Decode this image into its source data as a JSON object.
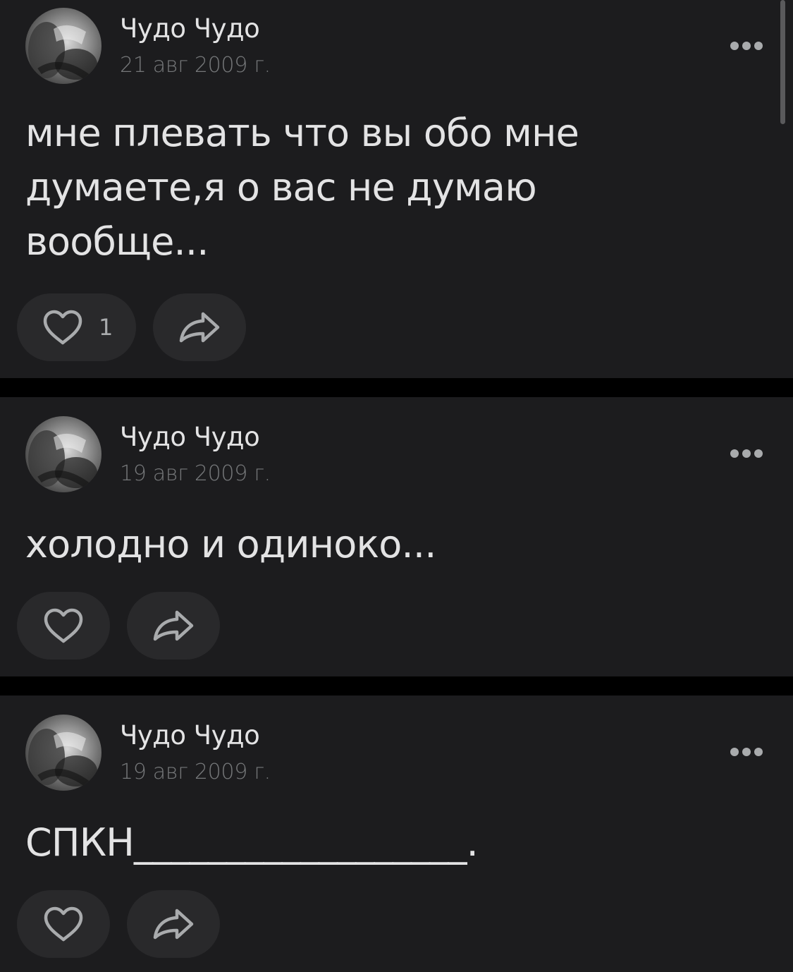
{
  "colors": {
    "background": "#000000",
    "card": "#1c1c1e",
    "button": "#29292b",
    "text_primary": "#e3e3e4",
    "text_secondary": "#76787a",
    "icon": "#a9abad"
  },
  "posts": [
    {
      "author": "Чудо Чудо",
      "date": "21 авг 2009 г.",
      "lines": [
        "мне плевать что вы обо мне",
        "думаете,я о вас не думаю",
        "вообще..."
      ],
      "likes": "1",
      "icons": {
        "avatar": "avatar",
        "more": "more-dots-icon",
        "like": "heart-icon",
        "share": "share-arrow-icon"
      }
    },
    {
      "author": "Чудо Чудо",
      "date": "19 авг 2009 г.",
      "lines": [
        "холодно и одиноко..."
      ],
      "likes": "",
      "icons": {
        "avatar": "avatar",
        "more": "more-dots-icon",
        "like": "heart-icon",
        "share": "share-arrow-icon"
      }
    },
    {
      "author": "Чудо Чудо",
      "date": "19 авг 2009 г.",
      "lines": [
        "СПКН__________________."
      ],
      "likes": "",
      "icons": {
        "avatar": "avatar",
        "more": "more-dots-icon",
        "like": "heart-icon",
        "share": "share-arrow-icon"
      }
    }
  ]
}
